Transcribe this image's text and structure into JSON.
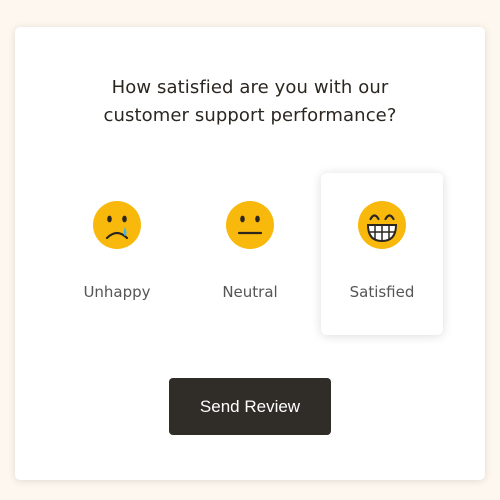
{
  "survey": {
    "question_line1": "How satisfied are you with our",
    "question_line2": "customer support performance?",
    "options": [
      {
        "label": "Unhappy",
        "icon": "sad-face-icon",
        "selected": false
      },
      {
        "label": "Neutral",
        "icon": "neutral-face-icon",
        "selected": false
      },
      {
        "label": "Satisfied",
        "icon": "grin-face-icon",
        "selected": true
      }
    ],
    "submit_label": "Send Review"
  },
  "colors": {
    "page_background": "#fdf7ef",
    "card_background": "#ffffff",
    "emoji_yellow": "#f8b90c",
    "emoji_features": "#2b2620",
    "tear": "#45b5e8",
    "button_background": "#302c28",
    "button_text": "#ffffff"
  }
}
